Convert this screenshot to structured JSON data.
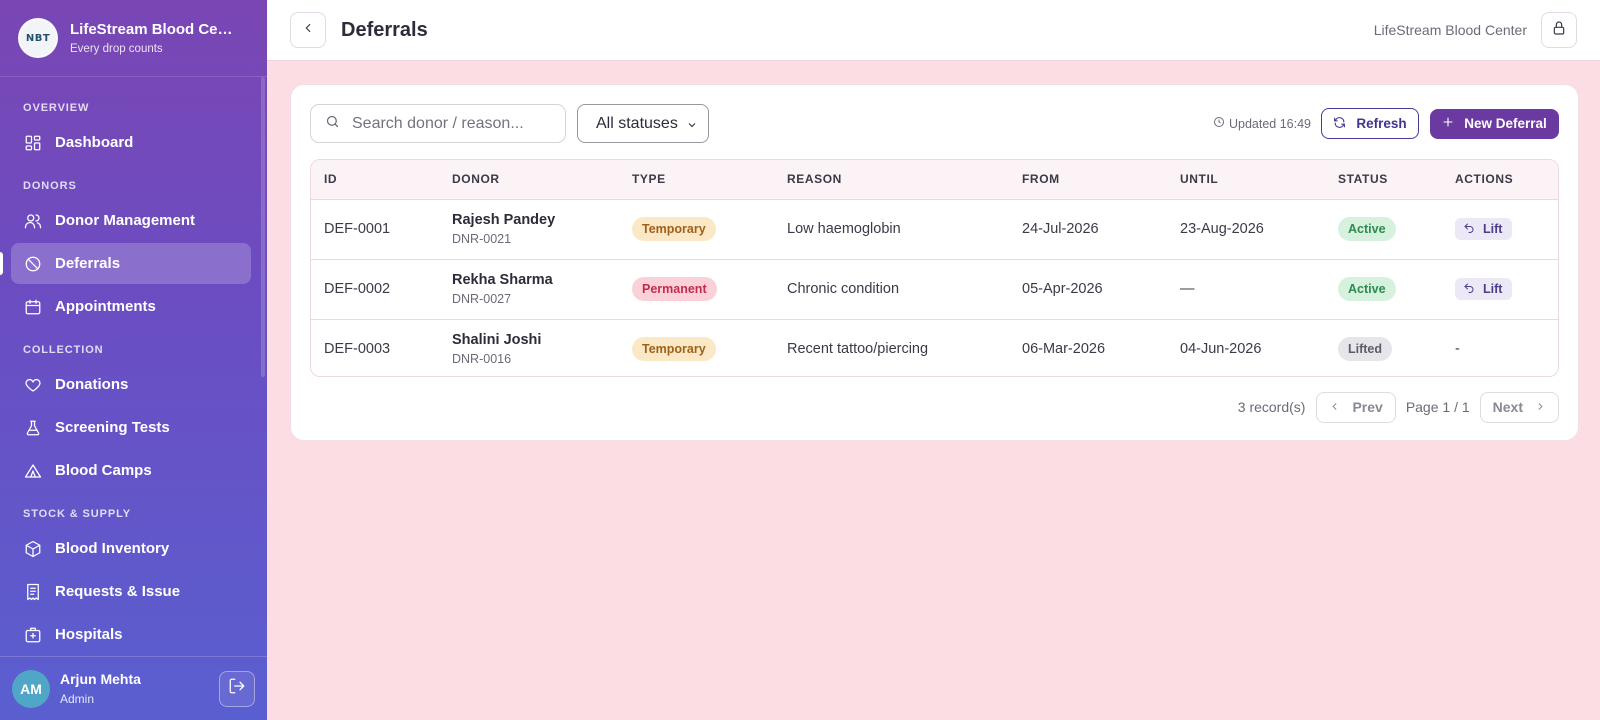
{
  "brand": {
    "name": "LifeStream Blood Center",
    "tagline": "Every drop counts",
    "logo_text": "NBT"
  },
  "sidebar": {
    "sections": [
      {
        "label": "OVERVIEW",
        "items": [
          {
            "label": "Dashboard",
            "icon": "dashboard-icon"
          }
        ]
      },
      {
        "label": "DONORS",
        "items": [
          {
            "label": "Donor Management",
            "icon": "users-icon"
          },
          {
            "label": "Deferrals",
            "icon": "ban-icon",
            "active": true
          },
          {
            "label": "Appointments",
            "icon": "calendar-icon"
          }
        ]
      },
      {
        "label": "COLLECTION",
        "items": [
          {
            "label": "Donations",
            "icon": "heart-icon"
          },
          {
            "label": "Screening Tests",
            "icon": "flask-icon"
          },
          {
            "label": "Blood Camps",
            "icon": "tent-icon"
          }
        ]
      },
      {
        "label": "STOCK & SUPPLY",
        "items": [
          {
            "label": "Blood Inventory",
            "icon": "box-icon"
          },
          {
            "label": "Requests & Issue",
            "icon": "receipt-icon"
          },
          {
            "label": "Hospitals",
            "icon": "hospital-icon"
          }
        ]
      }
    ]
  },
  "user": {
    "initials": "AM",
    "name": "Arjun Mehta",
    "role": "Admin"
  },
  "topbar": {
    "title": "Deferrals",
    "org": "LifeStream Blood Center"
  },
  "toolbar": {
    "search_placeholder": "Search donor / reason...",
    "status_filter": "All statuses",
    "updated": "Updated 16:49",
    "refresh_label": "Refresh",
    "new_label": "New Deferral"
  },
  "table": {
    "headers": [
      "ID",
      "DONOR",
      "TYPE",
      "REASON",
      "FROM",
      "UNTIL",
      "STATUS",
      "ACTIONS"
    ],
    "rows": [
      {
        "id": "DEF-0001",
        "donor": "Rajesh Pandey",
        "donor_id": "DNR-0021",
        "type": "Temporary",
        "reason": "Low haemoglobin",
        "from": "24-Jul-2026",
        "until": "23-Aug-2026",
        "status": "Active",
        "action": "Lift"
      },
      {
        "id": "DEF-0002",
        "donor": "Rekha Sharma",
        "donor_id": "DNR-0027",
        "type": "Permanent",
        "reason": "Chronic condition",
        "from": "05-Apr-2026",
        "until": "—",
        "status": "Active",
        "action": "Lift"
      },
      {
        "id": "DEF-0003",
        "donor": "Shalini Joshi",
        "donor_id": "DNR-0016",
        "type": "Temporary",
        "reason": "Recent tattoo/piercing",
        "from": "06-Mar-2026",
        "until": "04-Jun-2026",
        "status": "Lifted",
        "action": "-"
      }
    ]
  },
  "pager": {
    "records": "3 record(s)",
    "prev": "Prev",
    "page": "Page 1 / 1",
    "next": "Next"
  }
}
